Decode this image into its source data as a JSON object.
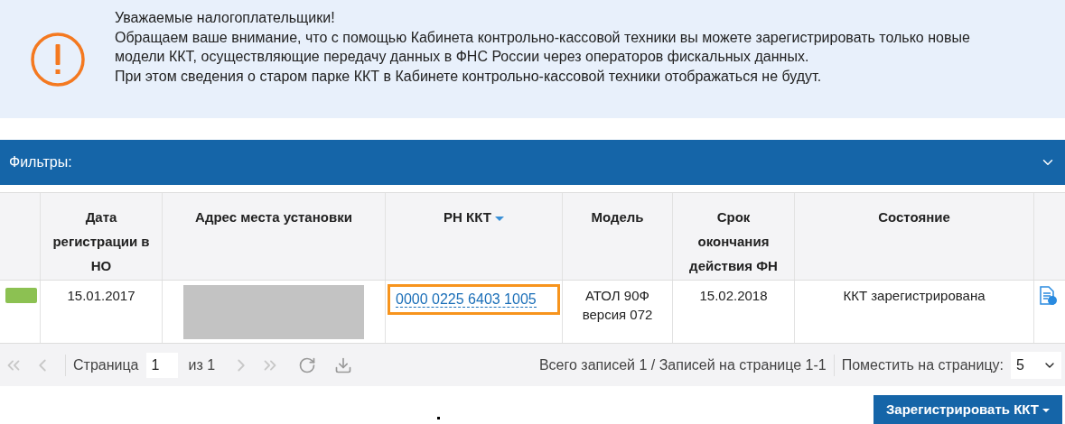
{
  "notice": {
    "title": "Уважаемые налогоплательщики!",
    "lines": [
      "Обращаем ваше внимание, что с помощью Кабинета контрольно-кассовой техники вы можете зарегистрировать только новые модели ККТ, осуществляющие передачу данных в ФНС России через операторов фискальных данных.",
      "При этом сведения о старом парке ККТ в Кабинете контрольно-кассовой техники отображаться не будут."
    ]
  },
  "filters": {
    "label": "Фильтры:",
    "expanded": false
  },
  "table": {
    "columns": [
      {
        "label": "Дата регистрации в НО",
        "sorted": false
      },
      {
        "label": "Адрес места установки",
        "sorted": false
      },
      {
        "label": "РН ККТ",
        "sorted": true
      },
      {
        "label": "Модель",
        "sorted": false
      },
      {
        "label": "Срок окончания действия ФН",
        "sorted": false
      },
      {
        "label": "Состояние",
        "sorted": false
      }
    ],
    "rows": [
      {
        "color": "#8cc152",
        "date": "15.01.2017",
        "rn": "0000 0225 6403 1005",
        "rn_highlighted": true,
        "model": "АТОЛ 90Ф версия 072",
        "fn_expiry": "15.02.2018",
        "state": "ККТ зарегистрирована"
      }
    ]
  },
  "pager": {
    "page_label": "Страница",
    "page": "1",
    "of": "из 1",
    "summary": "Всего записей 1 / Записей на странице 1-1",
    "per_page_label": "Поместить на страницу:",
    "per_page": "5"
  },
  "register_button": "Зарегистрировать ККТ"
}
